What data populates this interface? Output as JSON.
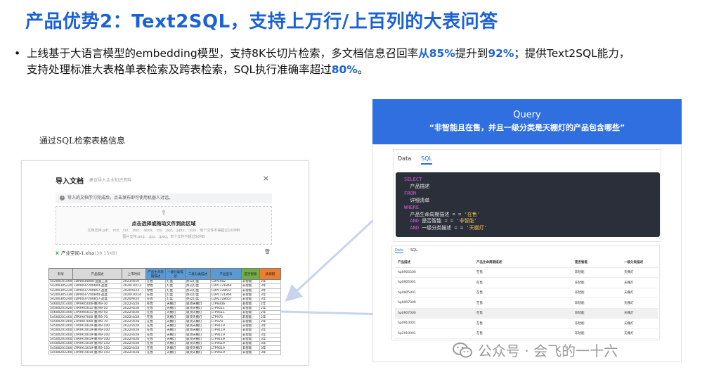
{
  "title": "产品优势2：Text2SQL，支持上万行/上百列的大表问答",
  "bullet": {
    "part1": "上线基于大语言模型的embedding模型，支持8K长切片检索，多文档信息召回率",
    "from": "从85%",
    "part2": "提升到",
    "to": "92%；",
    "part3": "提供Text2SQL能力，支持处理标准大表格单表检索及跨表检索，SQL执行准确率超过",
    "acc": "80%",
    "end": "。"
  },
  "caption": "通过SQL检索表格信息",
  "dialog": {
    "title": "导入文档",
    "subtitle": "建议导入企业知识资料",
    "close": "×",
    "info": "导入的文档学习完成后，点击发布即可使用机器人对话。",
    "upload_icon": "⇧",
    "upload_main": "点击选择或拖动文件到此区域",
    "upload_hint1": "文档支持.pdf、.md、.txt、.doc、.docx、.xls、.ppt、.pptx、.xlsx，单个文件不得超过100MB",
    "upload_hint2": "图片支持.png、.jpg、.jpeg，单个文件不超过50MB",
    "file_name": "产业空间-1.xlsx",
    "file_size": "(38.15KB)"
  },
  "sheet": {
    "headers": [
      "料号",
      "产品描述",
      "上市时间",
      "产品生命周期描述",
      "一级分类描述",
      "二级分类描述",
      "产品型号",
      "是否智能",
      "质保期"
    ],
    "rows": [
      [
        "542001014900",
        "LDP0034800-品盒丄盖",
        "2023/4/19",
        "在售",
        "灯盒",
        "办公灯盒",
        "LDP1482",
        "非智能",
        "2年"
      ],
      [
        "542003052200",
        "LDP0037200804-品盒",
        "2020/10/13",
        "停售",
        "灯盒",
        "办公灯盒",
        "LDP1721864",
        "非智能",
        "3年"
      ],
      [
        "542003052200",
        "LDP0037200857-品盒",
        "2020/9/24",
        "停售",
        "灯盒",
        "办公灯盒",
        "LDP1728657",
        "非智能",
        "3年"
      ],
      [
        "542003053300",
        "LDP0037200840-品盒",
        "2020/10/24",
        "在售",
        "灯盒",
        "办公灯盒",
        "LDP1721864",
        "非智能",
        "3年"
      ],
      [
        "542003052400",
        "LDP0037200857-品盒",
        "2020/9/24",
        "在售",
        "灯盒",
        "办公灯盒",
        "LDP1728657",
        "非智能",
        "3年"
      ],
      [
        "54600201400",
        "LTP0905006-鹏鸿9-30",
        "2022/4/28",
        "在售",
        "天棚灯",
        "吸顶天棚灯",
        "LTP9306",
        "非智能",
        "2年"
      ],
      [
        "54500201420",
        "LTP0905011-鹏鸿9-50",
        "2022/4/28",
        "在售",
        "天棚灯",
        "吸顶天棚灯",
        "LTP9511",
        "非智能",
        "2年"
      ],
      [
        "54600201400",
        "LTP0905011-鹏鸿9-50",
        "2022/4/28",
        "在售",
        "天棚灯",
        "吸顶天棚灯",
        "LTP9511",
        "非智能",
        "2年"
      ],
      [
        "54500201400",
        "LTP0907000-鹏鸿9-70",
        "2022/4/28",
        "在售",
        "天棚灯",
        "吸顶天棚灯",
        "LTP970",
        "非智能",
        "2年"
      ],
      [
        "54500201400",
        "LTP0907000-鹏鸿9-70",
        "2022/4/28",
        "在售",
        "天棚灯",
        "吸顶天棚灯",
        "LTP970",
        "非智能",
        "2年"
      ],
      [
        "54500201400",
        "LTP0910019-鹏鸿9-100",
        "2022/4/28",
        "在售",
        "天棚灯",
        "吸顶天棚灯",
        "LTP9119",
        "非智能",
        "3年"
      ],
      [
        "54500201400",
        "LTP0910019-鹏鸿9-100",
        "2022/4/28",
        "在售",
        "天棚灯",
        "吸顶天棚灯",
        "LTP9119",
        "非智能",
        "3年"
      ],
      [
        "54500201400",
        "LTP0910019-鹏鸿9-100",
        "2022/4/28",
        "在售",
        "天棚灯",
        "吸顶天棚灯",
        "LTP9119",
        "非智能",
        "3年"
      ],
      [
        "54500201400",
        "LTP0910019-鹏鸿9-100",
        "2022/4/28",
        "在售",
        "天棚灯",
        "吸顶天棚灯",
        "LTP9119",
        "非智能",
        "3年"
      ],
      [
        "54500201500",
        "LTP0915019-鹏鸿9-150",
        "2022/4/28",
        "在售",
        "天棚灯",
        "吸顶天棚灯",
        "LTP9519",
        "非智能",
        "3年"
      ],
      [
        "54500201500",
        "LTP0915019-鹏鸿9-150",
        "2022/4/28",
        "在售",
        "天棚灯",
        "吸顶天棚灯",
        "LTP9519",
        "非智能",
        "3年"
      ],
      [
        "54500202200",
        "LTP0915019-鹏鸿9-150",
        "2022/4/28",
        "在售",
        "天棚灯",
        "吸顶天棚灯",
        "LTP9519",
        "非智能",
        "3年"
      ]
    ]
  },
  "query": {
    "label": "Query",
    "question": "“非智能且在售，并且一级分类是天棚灯的产品包含哪些”"
  },
  "sql_card": {
    "tab_data": "Data",
    "tab_sql": "SQL",
    "lines": [
      {
        "kw": "SELECT",
        "rest": "",
        "str": ""
      },
      {
        "kw": "",
        "rest": "  产品描述",
        "str": ""
      },
      {
        "kw": "FROM",
        "rest": "",
        "str": ""
      },
      {
        "kw": "",
        "rest": "  详细清单",
        "str": ""
      },
      {
        "kw": "WHERE",
        "rest": "",
        "str": ""
      },
      {
        "kw": "",
        "rest": "  产品生命周期描述 = = ",
        "str": "'在售'"
      },
      {
        "kw": "  AND",
        "rest": " 是否智能 = = ",
        "str": "'非智能'"
      },
      {
        "kw": "  AND",
        "rest": " 一级分类描述 = = ",
        "str": "'天棚灯'"
      }
    ]
  },
  "result_card": {
    "tab_data": "Data",
    "tab_sql": "SQL",
    "headers": [
      "产品描述",
      "产品生命周期描述",
      "是否智能",
      "一级分类描述"
    ],
    "rows": [
      [
        "hp0905500",
        "在售",
        "非智能",
        "天棚灯"
      ],
      [
        "hp0905001",
        "在售",
        "非智能",
        "天棚灯"
      ],
      [
        "hp0905001",
        "在售",
        "非智能",
        "天棚灯"
      ],
      [
        "hp0907000",
        "在售",
        "非智能",
        "天棚灯"
      ],
      [
        "hp0907000",
        "在售",
        "非智能",
        "天棚灯"
      ],
      [
        "hp0910001",
        "在售",
        "非智能",
        "天棚灯"
      ],
      [
        "hp2910001",
        "在售",
        "非智能",
        "天棚灯"
      ]
    ]
  },
  "watermark": "公众号 · 会飞的一十六",
  "colors": {
    "accent": "#1b61d6",
    "query_bg": "#2f6fe0",
    "code_bg": "#2b2f3a",
    "keyword": "#d05bd6",
    "string": "#f0c24b"
  }
}
